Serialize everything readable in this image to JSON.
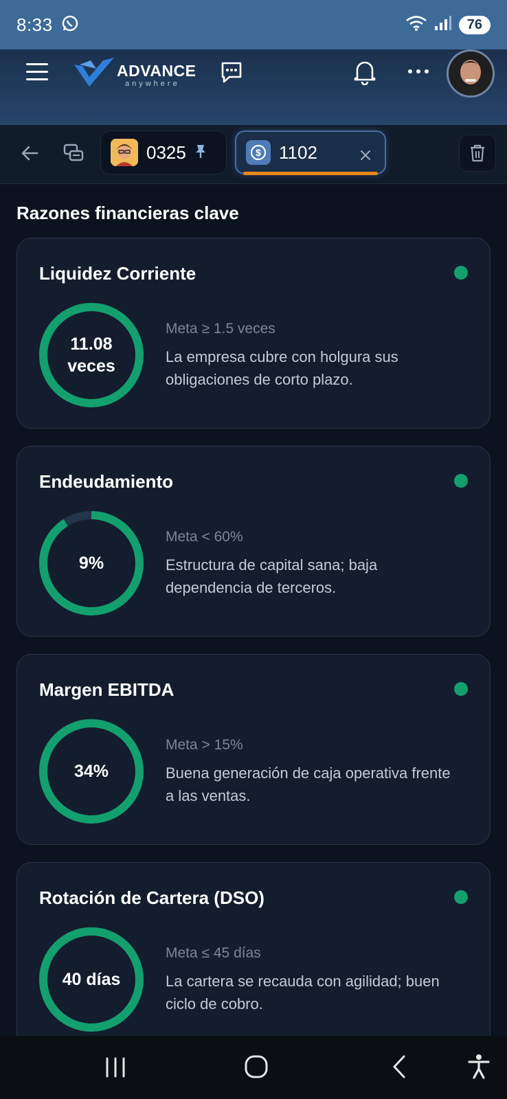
{
  "status_bar": {
    "time": "8:33",
    "battery": "76"
  },
  "header": {
    "logo_word": "ADVANCE",
    "logo_sub": "anywhere"
  },
  "tabs": [
    {
      "label": "0325",
      "pinned": true
    },
    {
      "label": "1102",
      "active": true
    }
  ],
  "section_title": "Razones financieras clave",
  "colors": {
    "ring": "#13a06e",
    "ring_track": "#24344a",
    "status_ok": "#13a06e",
    "active_tab_underline": "#e8861a"
  },
  "cards": [
    {
      "title": "Liquidez Corriente",
      "value": "11.08 veces",
      "ring_fill": 1.0,
      "meta": "Meta ≥ 1.5 veces",
      "description": "La empresa cubre con holgura sus obligaciones de corto plazo."
    },
    {
      "title": "Endeudamiento",
      "value": "9%",
      "ring_fill": 0.91,
      "meta": "Meta < 60%",
      "description": "Estructura de capital sana; baja dependencia de terceros."
    },
    {
      "title": "Margen EBITDA",
      "value": "34%",
      "ring_fill": 1.0,
      "meta": "Meta > 15%",
      "description": "Buena generación de caja operativa frente a las ventas."
    },
    {
      "title": "Rotación de Cartera (DSO)",
      "value": "40 días",
      "ring_fill": 1.0,
      "meta": "Meta ≤ 45 días",
      "description": "La cartera se recauda con agilidad; buen ciclo de cobro."
    }
  ]
}
